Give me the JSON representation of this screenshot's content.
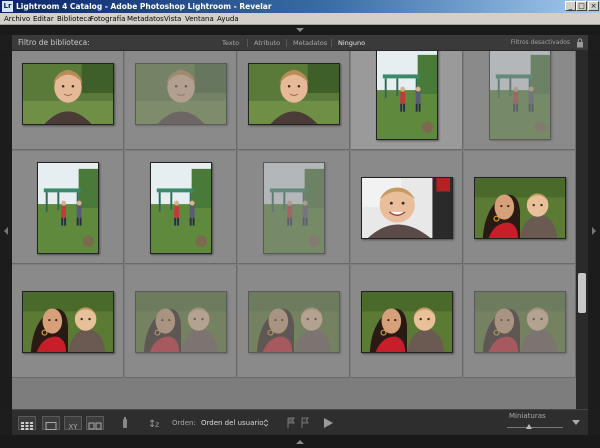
{
  "window": {
    "title": "Lightroom 4 Catalog - Adobe Photoshop Lightroom - Revelar",
    "app_icon": "Lr"
  },
  "menu": [
    "Archivo",
    "Editar",
    "Biblioteca",
    "Fotografía",
    "Metadatos",
    "Vista",
    "Ventana",
    "Ayuda"
  ],
  "filter_bar": {
    "label": "Filtro de biblioteca:",
    "tabs": [
      "Texto",
      "Atributo",
      "Metadatos",
      "Ninguno"
    ],
    "active_tab": "Ninguno",
    "status": "Filtros desactivados"
  },
  "grid": {
    "columns": 5,
    "rows": [
      [
        "girl",
        "girl",
        "girl",
        "playground",
        "playground"
      ],
      [
        "playground",
        "playground",
        "playground",
        "baby",
        "mother-child"
      ],
      [
        "mother-child",
        "mother-child",
        "mother-child",
        "mother-child",
        "mother-child"
      ]
    ],
    "dimmed": [
      [
        false,
        true,
        false,
        false,
        true
      ],
      [
        false,
        false,
        true,
        false,
        false
      ],
      [
        false,
        true,
        true,
        false,
        true
      ]
    ],
    "selected": [
      [
        false,
        false,
        false,
        true,
        false
      ],
      [
        false,
        false,
        false,
        false,
        false
      ],
      [
        false,
        false,
        false,
        false,
        false
      ]
    ]
  },
  "toolbar": {
    "sort_label": "Orden:",
    "sort_value": "Orden del usuario",
    "thumb_label": "Miniaturas",
    "thumb_level": 0.4
  }
}
